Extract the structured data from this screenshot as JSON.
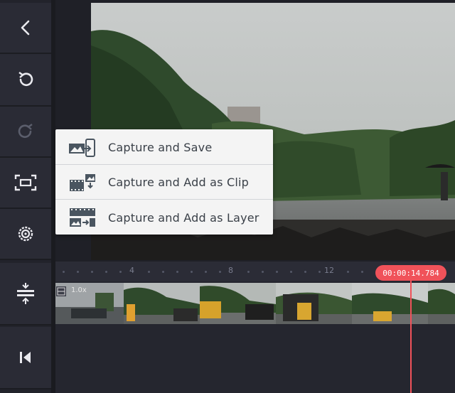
{
  "sidebar": {
    "icons": [
      "back-chevron-icon",
      "undo-icon",
      "redo-icon",
      "capture-frame-icon",
      "settings-gear-icon",
      "layer-align-icon",
      "skip-to-start-icon"
    ]
  },
  "capture_menu": {
    "items": [
      {
        "label": "Capture and Save",
        "icon": "capture-save-icon"
      },
      {
        "label": "Capture and Add as Clip",
        "icon": "capture-clip-icon"
      },
      {
        "label": "Capture and Add as Layer",
        "icon": "capture-layer-icon"
      }
    ]
  },
  "timeline": {
    "ruler_ticks": [
      "4",
      "8",
      "12"
    ],
    "current_time": "00:00:14.784",
    "clip_speed": "1.0x"
  },
  "colors": {
    "accent": "#f0525a",
    "sidebar_bg": "#2a2b35",
    "menu_bg": "#f4f4f4"
  }
}
